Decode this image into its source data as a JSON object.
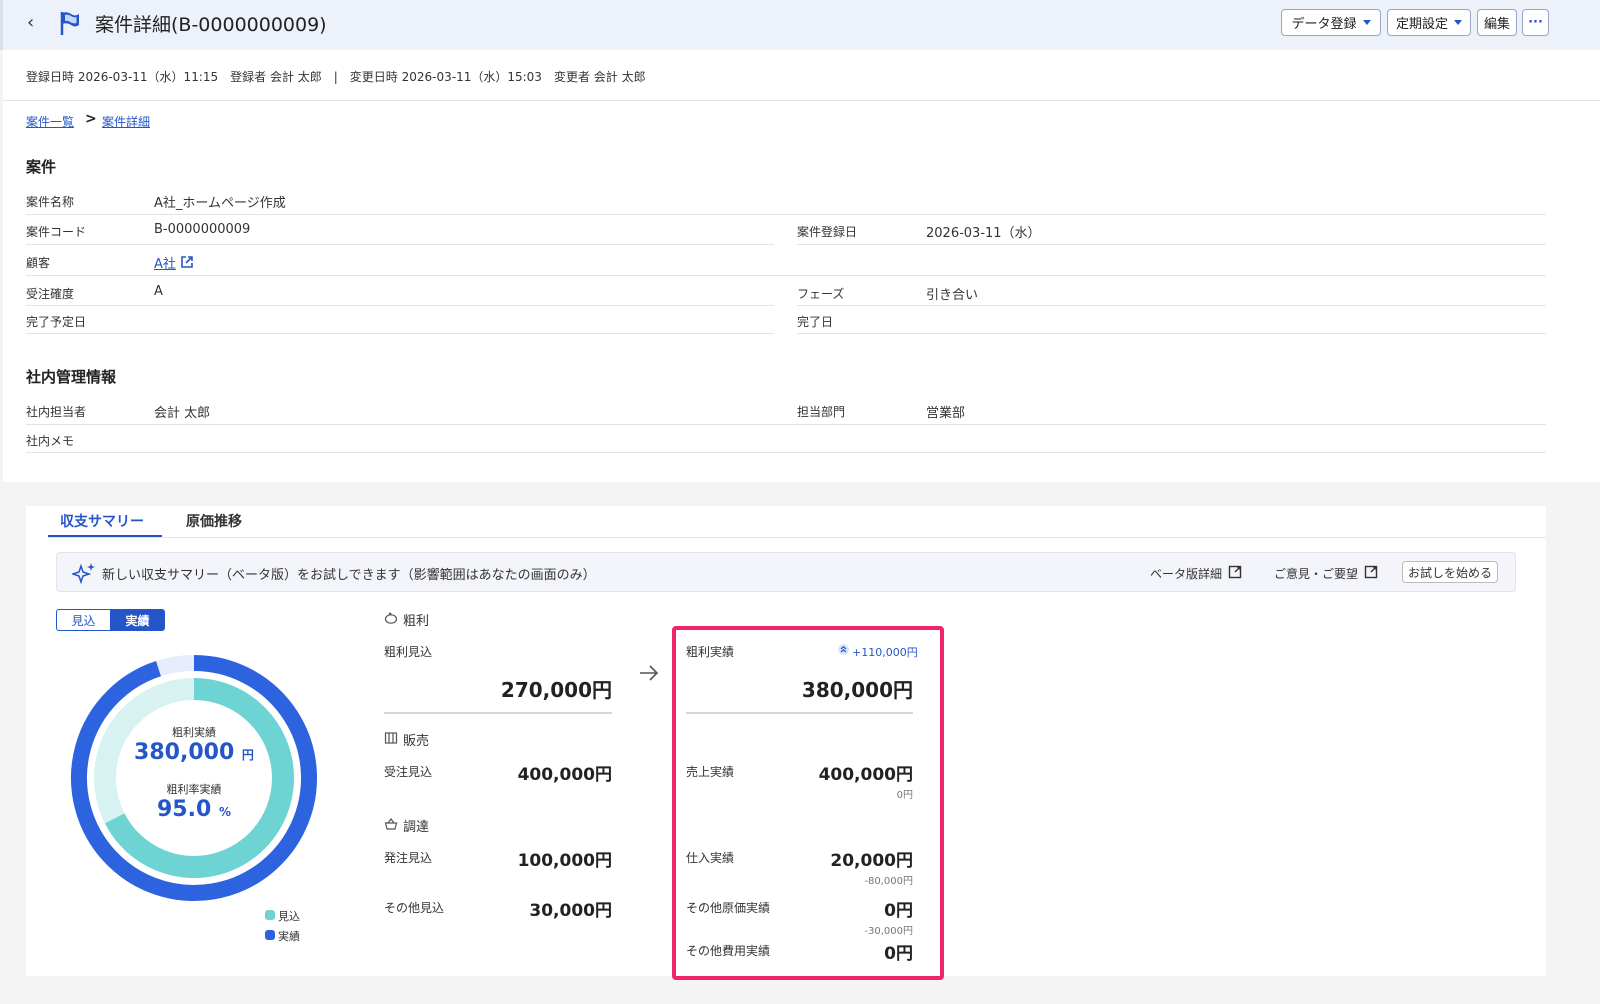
{
  "header": {
    "title": "案件詳細(B-0000000009)",
    "buttons": {
      "data_register": "データ登録",
      "periodic": "定期設定",
      "edit": "編集",
      "more": "···"
    }
  },
  "meta": {
    "line": "登録日時 2026-03-11（水）11:15　登録者 会計 太郎　|　変更日時 2026-03-11（水）15:03　変更者 会計 太郎"
  },
  "breadcrumb": {
    "list": "案件一覧",
    "sep": ">",
    "detail": "案件詳細"
  },
  "project": {
    "heading": "案件",
    "name_label": "案件名称",
    "name": "A社_ホームページ作成",
    "code_label": "案件コード",
    "code": "B-0000000009",
    "regdate_label": "案件登録日",
    "regdate": "2026-03-11（水）",
    "customer_label": "顧客",
    "customer": "A社",
    "prob_label": "受注確度",
    "prob": "A",
    "phase_label": "フェーズ",
    "phase": "引き合い",
    "due_label": "完了予定日",
    "done_label": "完了日"
  },
  "internal": {
    "heading": "社内管理情報",
    "person_label": "社内担当者",
    "person": "会計 太郎",
    "dept_label": "担当部門",
    "dept": "営業部",
    "memo_label": "社内メモ"
  },
  "tabs": {
    "summary": "収支サマリー",
    "cost": "原価推移"
  },
  "banner": {
    "text": "新しい収支サマリー（ベータ版）をお試しできます（影響範囲はあなたの画面のみ）",
    "beta_link": "ベータ版詳細",
    "feedback_link": "ご意見・ご要望",
    "try_button": "お試しを始める"
  },
  "toggle": {
    "forecast": "見込",
    "actual": "実績"
  },
  "donut": {
    "profit_label": "粗利実績",
    "profit_value": "380,000",
    "profit_unit": "円",
    "rate_label": "粗利率実績",
    "rate_value": "95.0",
    "rate_unit": "%",
    "legend_forecast": "見込",
    "legend_actual": "実績",
    "forecast_fraction": 0.675,
    "actual_fraction": 0.95,
    "colors": {
      "forecast": "#6dd3d3",
      "forecast_bg": "#d8f2f2",
      "actual": "#2e63e0",
      "actual_bg": "#e6ecfb"
    }
  },
  "forecast": {
    "gross_heading": "粗利",
    "gross_label": "粗利見込",
    "gross_value": "270,000円",
    "sales_heading": "販売",
    "sales_label": "受注見込",
    "sales_value": "400,000円",
    "proc_heading": "調達",
    "order_label": "発注見込",
    "order_value": "100,000円",
    "other_label": "その他見込",
    "other_value": "30,000円"
  },
  "actual": {
    "gross_label": "粗利実績",
    "gross_diff": "+110,000円",
    "gross_value": "380,000円",
    "sales_label": "売上実績",
    "sales_value": "400,000円",
    "sales_diff": "0円",
    "purchase_label": "仕入実績",
    "purchase_value": "20,000円",
    "purchase_diff": "-80,000円",
    "other_cost_label": "その他原価実績",
    "other_cost_value": "0円",
    "other_cost_diff": "-30,000円",
    "other_exp_label": "その他費用実績",
    "other_exp_value": "0円"
  }
}
